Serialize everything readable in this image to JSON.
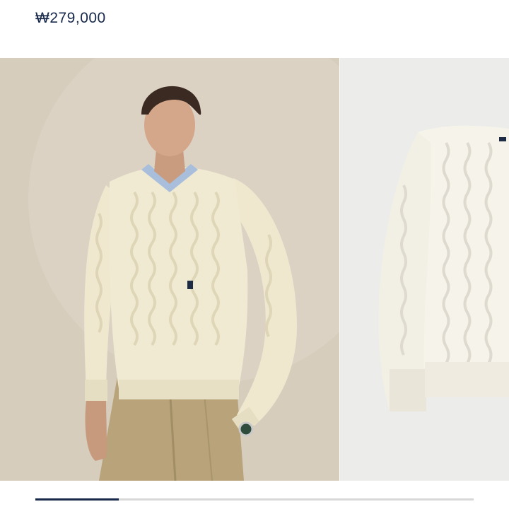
{
  "product": {
    "price": "₩279,000"
  },
  "gallery": {
    "slides": [
      {
        "name": "model-wearing-cable-knit-sweater"
      },
      {
        "name": "cable-knit-sweater-flat"
      }
    ],
    "progress": 0.19,
    "colors": {
      "sweater": "#f1ead2",
      "chinos": "#b8a37a",
      "shirt": "#a9bedb",
      "progress_fill": "#17284a",
      "progress_track": "#d8d8d8"
    }
  }
}
